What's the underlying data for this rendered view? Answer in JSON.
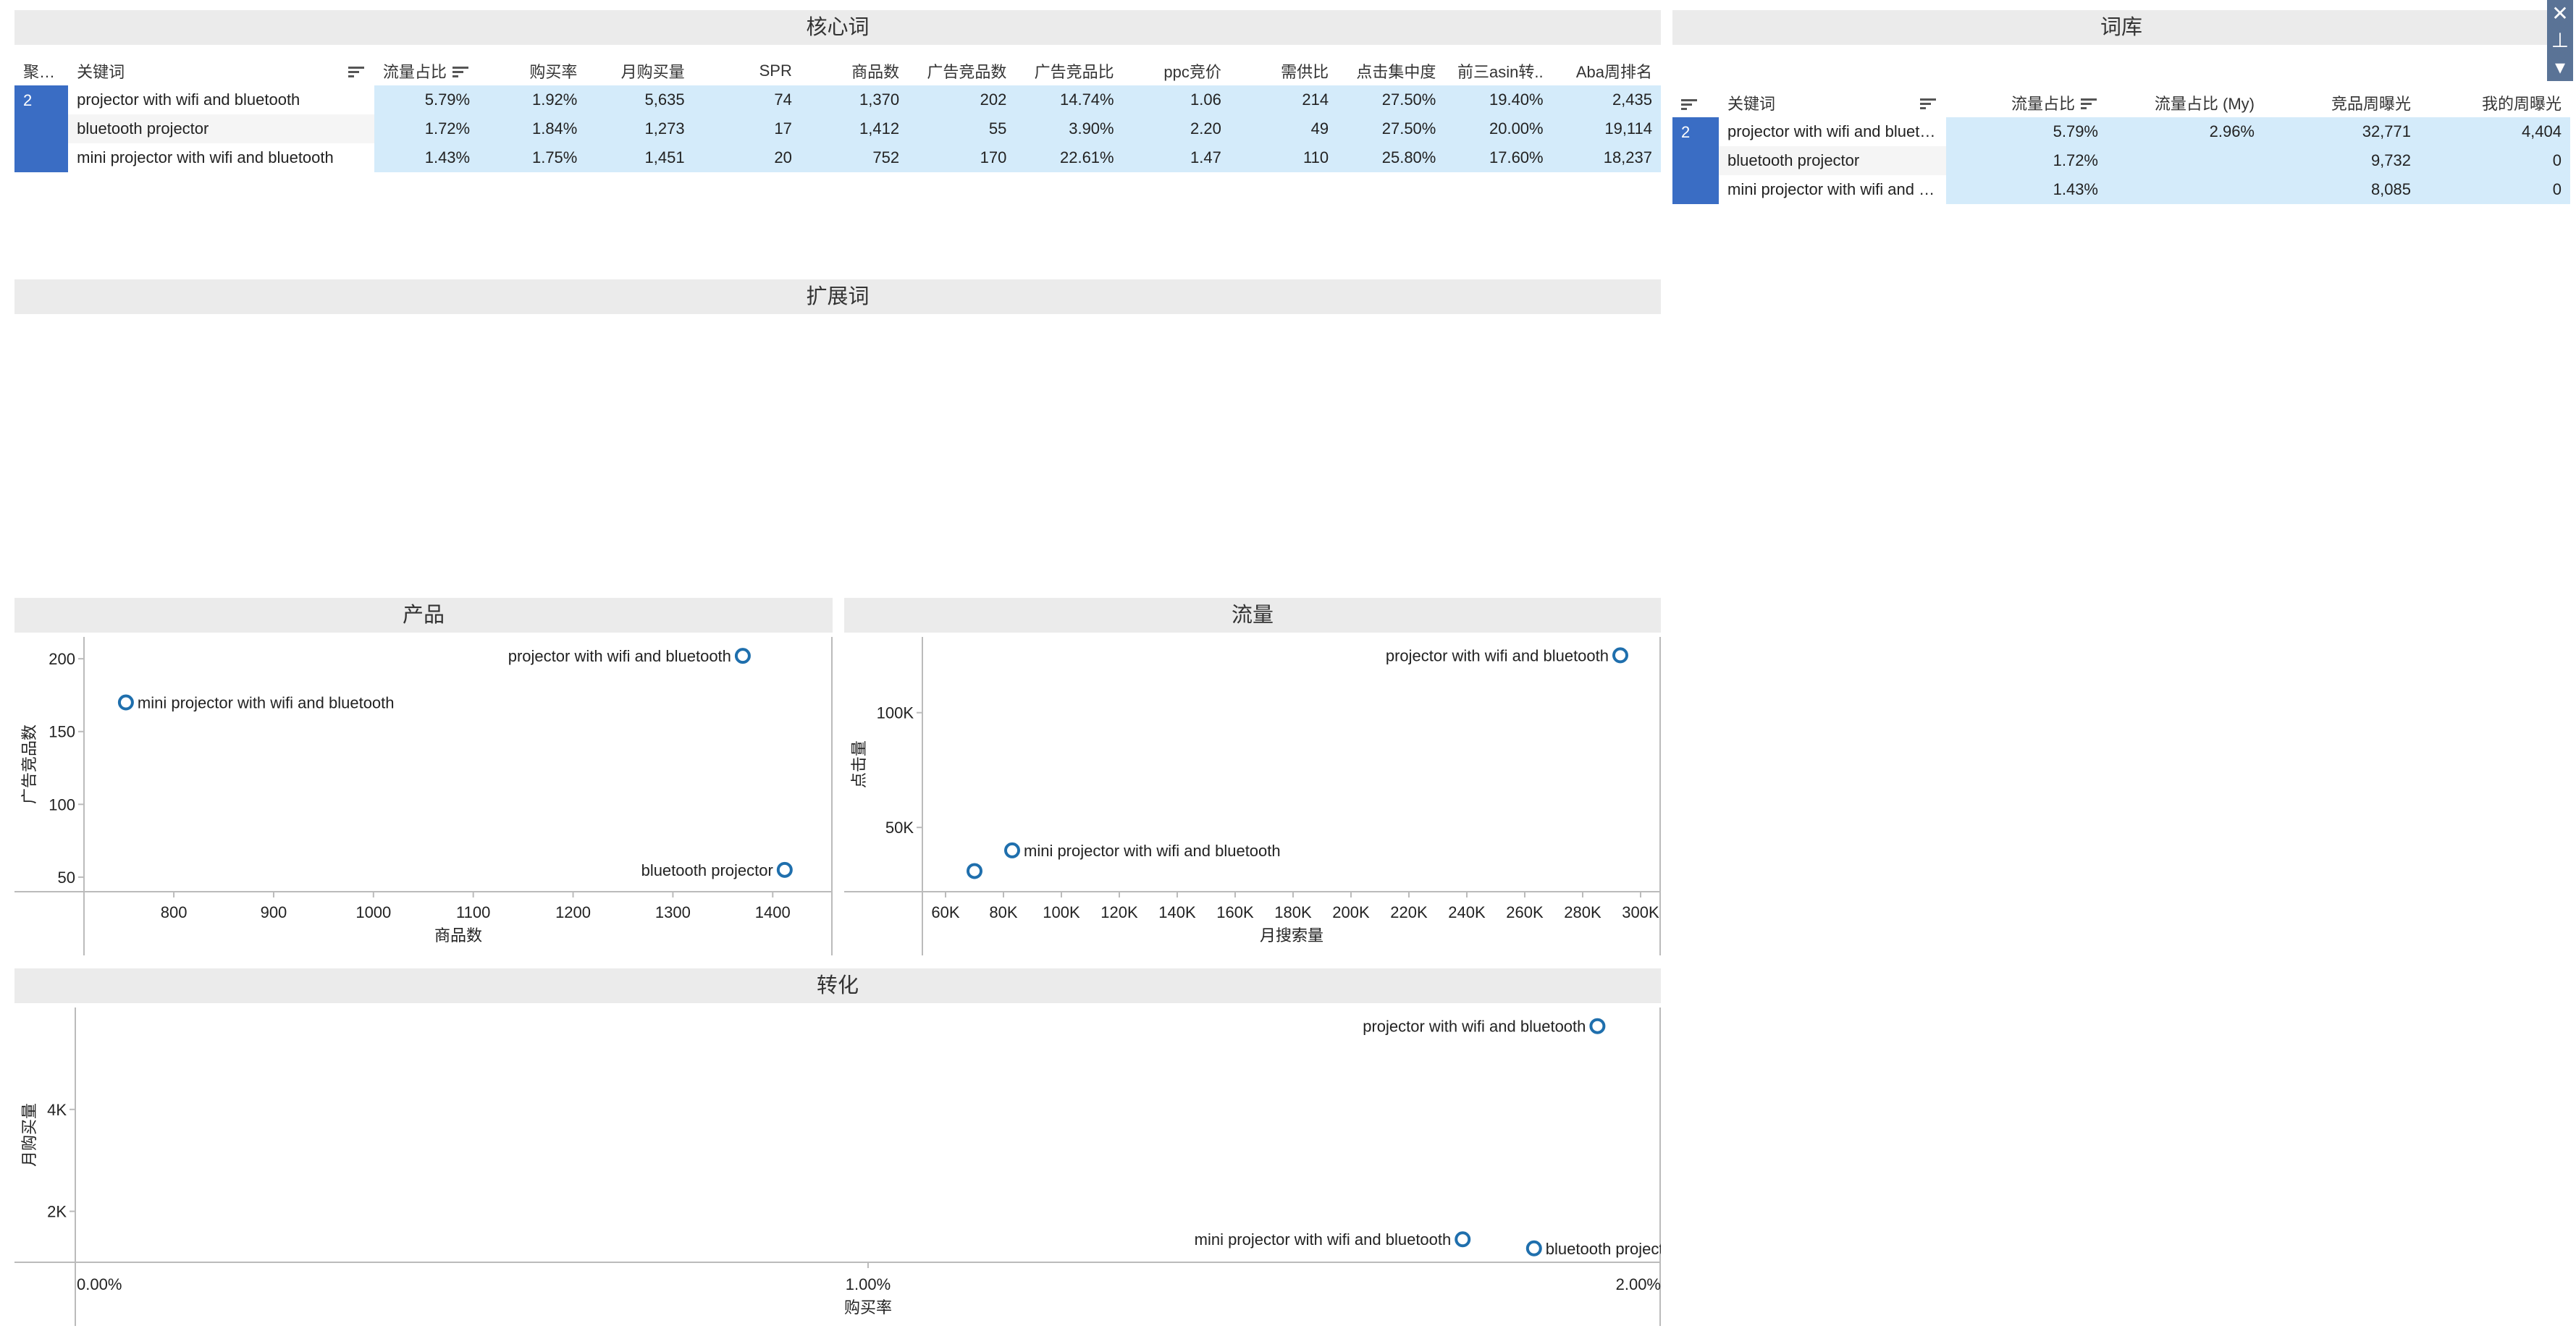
{
  "core": {
    "title": "核心词",
    "headers": [
      "聚类..",
      "关键词",
      "流量占比",
      "购买率",
      "月购买量",
      "SPR",
      "商品数",
      "广告竞品数",
      "广告竞品比",
      "ppc竞价",
      "需供比",
      "点击集中度",
      "前三asin转..",
      "Aba周排名"
    ],
    "cluster": "2",
    "rows": [
      [
        "projector with wifi and bluetooth",
        "5.79%",
        "1.92%",
        "5,635",
        "74",
        "1,370",
        "202",
        "14.74%",
        "1.06",
        "214",
        "27.50%",
        "19.40%",
        "2,435"
      ],
      [
        "bluetooth projector",
        "1.72%",
        "1.84%",
        "1,273",
        "17",
        "1,412",
        "55",
        "3.90%",
        "2.20",
        "49",
        "27.50%",
        "20.00%",
        "19,114"
      ],
      [
        "mini projector with wifi and bluetooth",
        "1.43%",
        "1.75%",
        "1,451",
        "20",
        "752",
        "170",
        "22.61%",
        "1.47",
        "110",
        "25.80%",
        "17.60%",
        "18,237"
      ]
    ]
  },
  "lexicon": {
    "title": "词库",
    "headers": [
      "关键词",
      "流量占比",
      "流量占比 (My)",
      "竞品周曝光",
      "我的周曝光"
    ],
    "cluster": "2",
    "rows": [
      [
        "projector with wifi and bluetoo..",
        "5.79%",
        "2.96%",
        "32,771",
        "4,404"
      ],
      [
        "bluetooth projector",
        "1.72%",
        "",
        "9,732",
        "0"
      ],
      [
        "mini projector with wifi and bl..",
        "1.43%",
        "",
        "8,085",
        "0"
      ]
    ]
  },
  "expansion": {
    "title": "扩展词"
  },
  "chart_data": [
    {
      "type": "scatter",
      "title": "产品",
      "xlabel": "商品数",
      "ylabel": "广告竞品数",
      "xticks": [
        "800",
        "900",
        "1000",
        "1100",
        "1200",
        "1300",
        "1400"
      ],
      "yticks": [
        "50",
        "100",
        "150",
        "200"
      ],
      "xlim": [
        710,
        1460
      ],
      "ylim": [
        40,
        215
      ],
      "points": [
        {
          "label": "projector with wifi and bluetooth",
          "x": 1370,
          "y": 202
        },
        {
          "label": "mini projector with wifi and bluetooth",
          "x": 752,
          "y": 170
        },
        {
          "label": "bluetooth projector",
          "x": 1412,
          "y": 55
        }
      ]
    },
    {
      "type": "scatter",
      "title": "流量",
      "xlabel": "月搜索量",
      "ylabel": "点击量",
      "xticks": [
        "60K",
        "80K",
        "100K",
        "120K",
        "140K",
        "160K",
        "180K",
        "200K",
        "220K",
        "240K",
        "260K",
        "280K",
        "300K"
      ],
      "yticks": [
        "50K",
        "100K"
      ],
      "xlim": [
        52000,
        307000
      ],
      "ylim": [
        22000,
        133000
      ],
      "points": [
        {
          "label": "projector with wifi and bluetooth",
          "x": 293000,
          "y": 125000
        },
        {
          "label": "mini projector with wifi and bluetooth",
          "x": 83000,
          "y": 40000
        },
        {
          "label": "",
          "x": 70000,
          "y": 31000
        }
      ]
    },
    {
      "type": "scatter",
      "title": "转化",
      "xlabel": "购买率",
      "ylabel": "月购买量",
      "xticks": [
        "0.00%",
        "1.00%",
        "2.00%"
      ],
      "yticks": [
        "2K",
        "4K"
      ],
      "xlim": [
        0,
        0.02
      ],
      "ylim": [
        1000,
        6000
      ],
      "points": [
        {
          "label": "projector with wifi and bluetooth",
          "x": 0.0192,
          "y": 5635
        },
        {
          "label": "mini projector with wifi and bluetooth",
          "x": 0.0175,
          "y": 1451
        },
        {
          "label": "bluetooth projector",
          "x": 0.0184,
          "y": 1273
        }
      ]
    }
  ]
}
